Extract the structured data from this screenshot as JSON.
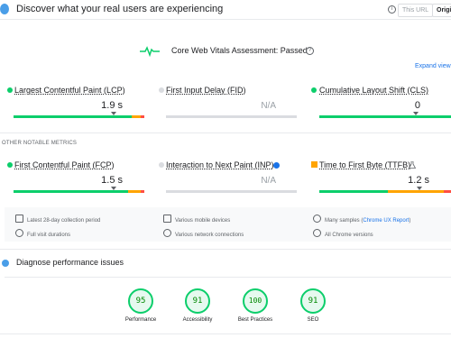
{
  "header": {
    "title": "Discover what your real users are experiencing",
    "info_glyph": "i",
    "btn_this_url": "This URL",
    "btn_origin": "Origin"
  },
  "cwv": {
    "title": "Core Web Vitals Assessment:",
    "status": "Passed",
    "help_glyph": "?",
    "expand": "Expand view"
  },
  "metrics_top": [
    {
      "label": "Largest Contentful Paint (LCP)",
      "value": "1.9 s",
      "dot_color": "#0cce6b"
    },
    {
      "label": "First Input Delay (FID)",
      "value": "N/A",
      "dot_color": "#dadce0"
    },
    {
      "label": "Cumulative Layout Shift (CLS)",
      "value": "0",
      "dot_color": "#0cce6b"
    }
  ],
  "other_label": "OTHER NOTABLE METRICS",
  "metrics_other": [
    {
      "label": "First Contentful Paint (FCP)",
      "value": "1.5 s",
      "dot_color": "#0cce6b"
    },
    {
      "label": "Interaction to Next Paint (INP)",
      "value": "N/A",
      "dot_color": "#dadce0"
    },
    {
      "label": "Time to First Byte (TTFB)",
      "value": "1.2 s",
      "dot_color": "#ffa400"
    }
  ],
  "info": {
    "collection": "Latest 28-day collection period",
    "devices": "Various mobile devices",
    "samples_prefix": "Many samples (",
    "samples_link": "Chrome UX Report",
    "samples_suffix": ")",
    "durations": "Full visit durations",
    "network": "Various network connections",
    "versions": "All Chrome versions"
  },
  "diagnose": {
    "title": "Diagnose performance issues"
  },
  "scores": [
    {
      "value": "95",
      "label": "Performance"
    },
    {
      "value": "91",
      "label": "Accessibility"
    },
    {
      "value": "100",
      "label": "Best Practices"
    },
    {
      "value": "91",
      "label": "SEO"
    }
  ]
}
